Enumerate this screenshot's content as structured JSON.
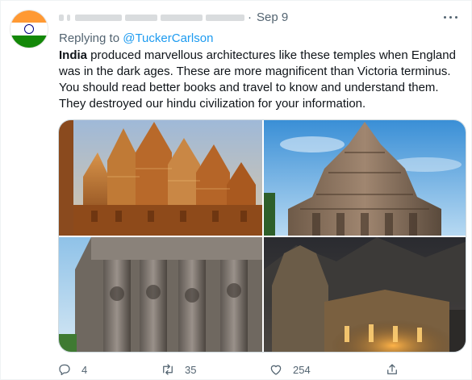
{
  "tweet": {
    "date_separator": "·",
    "date": "Sep 9",
    "replying_prefix": "Replying to ",
    "replying_handle": "@TuckerCarlson",
    "text_bold": "India",
    "text_rest": " produced marvellous architectures like these temples when England was in the dark ages. These are more magnificent than Victoria terminus. You should read better books and travel to know and understand them. They destroyed our hindu civilization for your information.",
    "avatar_flag_colors": [
      "#FF9933",
      "#FFFFFF",
      "#138808"
    ],
    "media": [
      {
        "icon": "temple-photo-sandstone-jain-temple"
      },
      {
        "icon": "temple-photo-stone-vimana-blue-sky"
      },
      {
        "icon": "temple-photo-yali-pillars"
      },
      {
        "icon": "temple-photo-mountain-temple-night"
      }
    ],
    "actions": {
      "reply_count": "4",
      "retweet_count": "35",
      "like_count": "254"
    }
  },
  "colors": {
    "accent": "#1d9bf0",
    "secondary_text": "#536471",
    "primary_text": "#0f1419"
  }
}
